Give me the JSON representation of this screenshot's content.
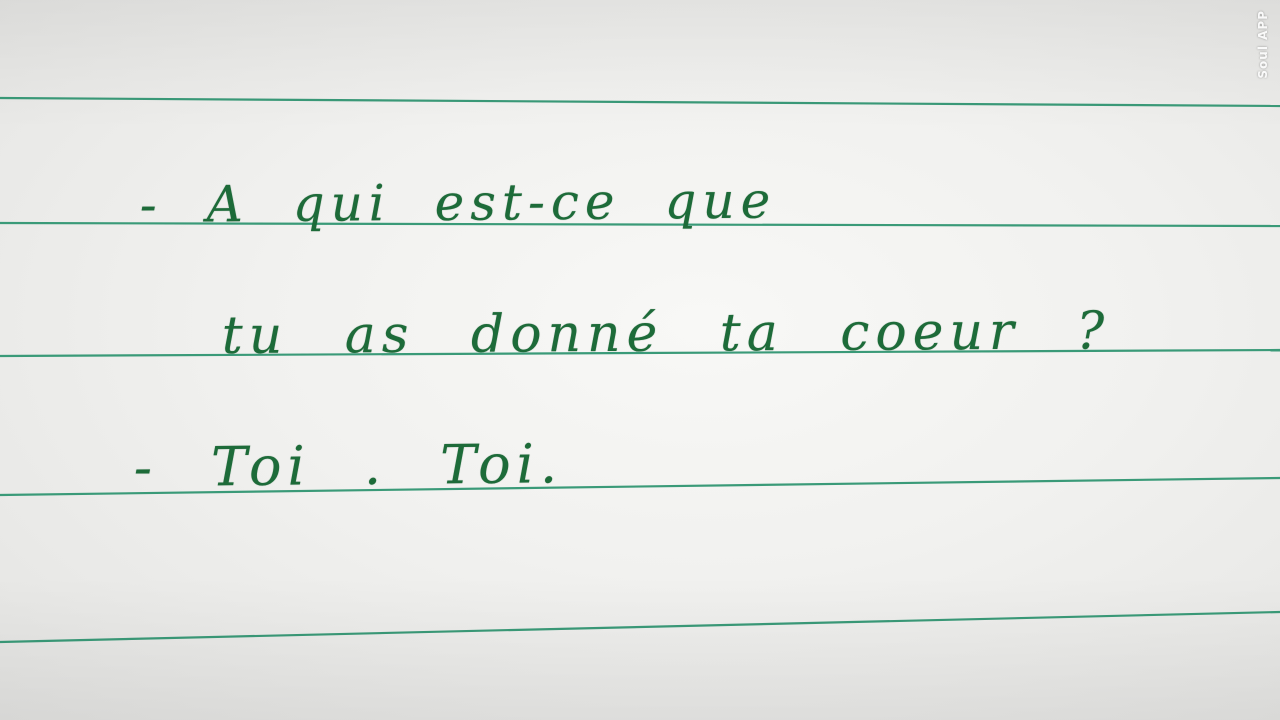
{
  "photo": {
    "description_colors": {
      "paper": "#f2f2f0",
      "ruled_line": "#3a9a78",
      "ink": "#1d6b39"
    }
  },
  "handwriting": {
    "line1": "- A qui est-ce que",
    "line2": "tu as donné ta coeur ?",
    "line3": "- Toi . Toi."
  },
  "watermark": {
    "text": "Soul APP"
  }
}
